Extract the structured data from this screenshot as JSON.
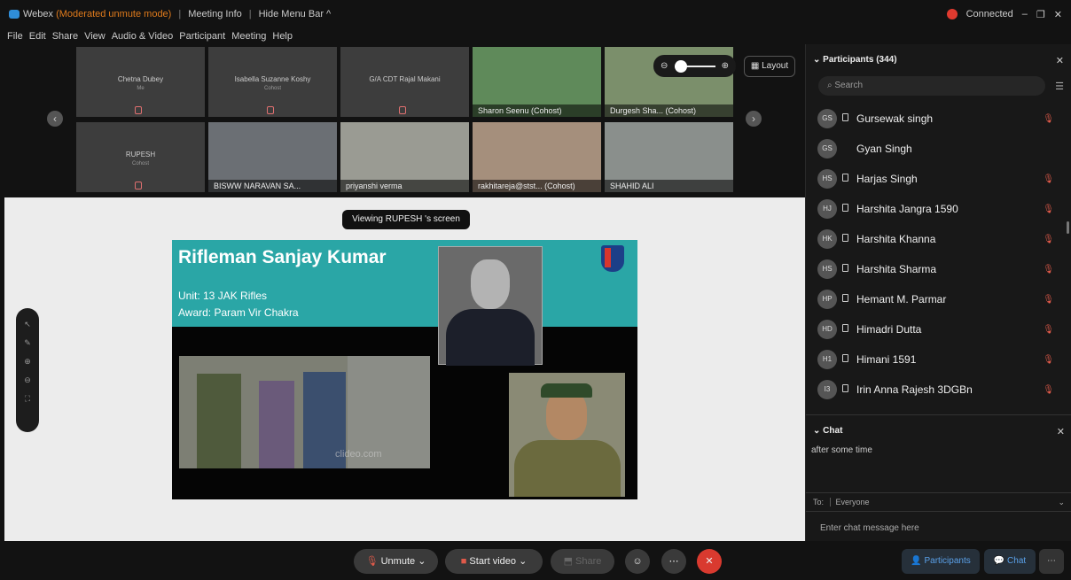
{
  "titlebar": {
    "app_name": "Webex",
    "mode": "(Moderated unmute mode)",
    "meeting_info": "Meeting Info",
    "hide_menu": "Hide Menu Bar ^",
    "status": "Connected",
    "status_color": "#e03a2f"
  },
  "menu": [
    "File",
    "Edit",
    "Share",
    "View",
    "Audio & Video",
    "Participant",
    "Meeting",
    "Help"
  ],
  "video_tiles_row1": [
    {
      "name": "Chetna Dubey",
      "sub": "Me"
    },
    {
      "name": "Isabella Suzanne Koshy",
      "sub": "Cohost"
    },
    {
      "name": "G/A CDT Rajal Makani",
      "sub": ""
    },
    {
      "label": "Sharon Seenu (Cohost)"
    },
    {
      "label": "Durgesh Sha... (Cohost)"
    }
  ],
  "video_tiles_row2": [
    {
      "name": "RUPESH",
      "sub": "Cohost"
    },
    {
      "label": "BISWW NARAVAN SA..."
    },
    {
      "label": "priyanshi verma"
    },
    {
      "label": "rakhitareja@stst... (Cohost)"
    },
    {
      "label": "SHAHID ALI"
    }
  ],
  "layout_button": "Layout",
  "viewing_banner": "Viewing RUPESH 's screen",
  "slide": {
    "title": "Rifleman Sanjay Kumar",
    "unit": "Unit: 13 JAK Rifles",
    "award": "Award: Param Vir Chakra",
    "watermark": "clideo.com"
  },
  "controls": {
    "unmute": "Unmute",
    "start_video": "Start video",
    "share": "Share"
  },
  "right_buttons": {
    "participants": "Participants",
    "chat": "Chat"
  },
  "participants": {
    "header": "Participants (344)",
    "search_placeholder": "Search",
    "list": [
      {
        "initials": "GS",
        "name": "Gursewak singh"
      },
      {
        "initials": "GS",
        "name": "Gyan Singh"
      },
      {
        "initials": "HS",
        "name": "Harjas Singh"
      },
      {
        "initials": "HJ",
        "name": "Harshita Jangra 1590"
      },
      {
        "initials": "HK",
        "name": "Harshita Khanna"
      },
      {
        "initials": "HS",
        "name": "Harshita Sharma"
      },
      {
        "initials": "HP",
        "name": "Hemant M. Parmar"
      },
      {
        "initials": "HD",
        "name": "Himadri Dutta"
      },
      {
        "initials": "H1",
        "name": "Himani 1591"
      },
      {
        "initials": "I3",
        "name": "Irin Anna Rajesh 3DGBn"
      }
    ]
  },
  "chat": {
    "header": "Chat",
    "message": "after some time",
    "to_label": "To:",
    "to_value": "Everyone",
    "input_placeholder": "Enter chat message here"
  }
}
